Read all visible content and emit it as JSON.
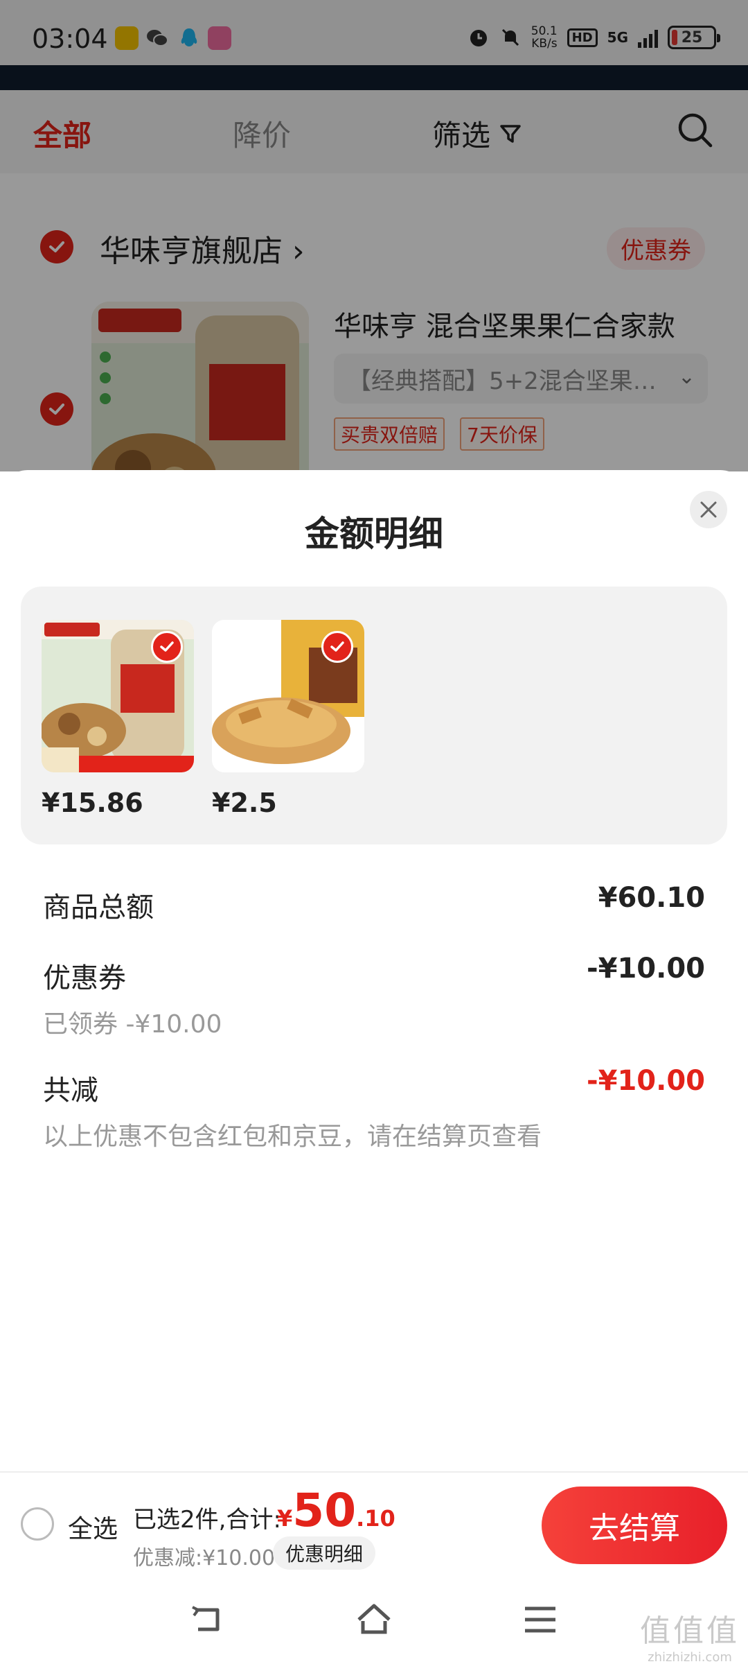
{
  "status_bar": {
    "time": "03:04",
    "net_speed_value": "50.1",
    "net_speed_unit": "KB/s",
    "hd_label": "HD",
    "network_label": "5G",
    "battery": "25"
  },
  "tabs": {
    "all": "全部",
    "price_drop": "降价",
    "filter": "筛选"
  },
  "shop": {
    "name": "华味亨旗舰店",
    "chevron": "›",
    "coupon": "优惠券",
    "product_title": "华味亨 混合坚果果仁合家款",
    "variant": "【经典搭配】5+2混合坚果…",
    "tags": [
      "买贵双倍赔",
      "7天价保"
    ]
  },
  "sheet": {
    "title": "金额明细",
    "items": [
      {
        "price": "¥15.86"
      },
      {
        "price": "¥2.5"
      }
    ],
    "goods_total_label": "商品总额",
    "goods_total_value": "¥60.10",
    "coupon_label": "优惠券",
    "coupon_value": "-¥10.00",
    "coupon_sub": "已领券 -¥10.00",
    "total_reduce_label": "共减",
    "total_reduce_value": "-¥10.00",
    "note": "以上优惠不包含红包和京豆，请在结算页查看"
  },
  "bottom_bar": {
    "select_all": "全选",
    "selected_summary": "已选2件,合计:",
    "currency": "¥",
    "total_int": "50",
    "total_dec": ".10",
    "discount": "优惠减:¥10.00",
    "detail_chip": "优惠明细",
    "checkout": "去结算"
  },
  "watermark": {
    "text": "值值值",
    "domain": "zhizhizhi.com"
  },
  "colors": {
    "accent": "#e2231a",
    "overlay": "rgba(0,0,0,0.4)"
  }
}
